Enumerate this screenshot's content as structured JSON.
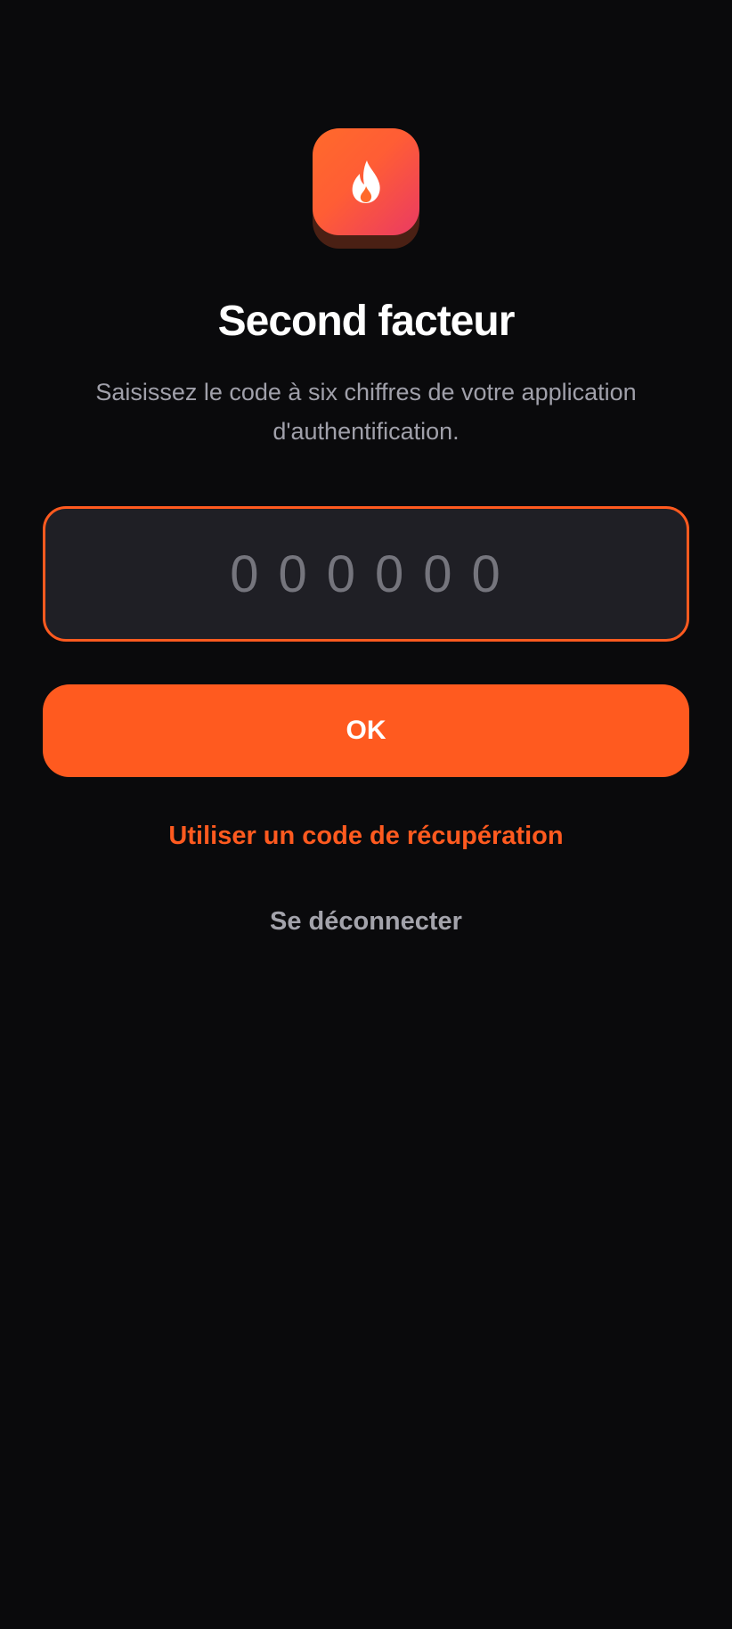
{
  "logo": {
    "icon": "flame-icon",
    "gradient_start": "#ff6a2b",
    "gradient_end": "#ea3a63"
  },
  "title": "Second facteur",
  "subtitle": "Saisissez le code à six chiffres de votre application d'authentification.",
  "code_input": {
    "value": "",
    "placeholder": "000000"
  },
  "ok_button": {
    "label": "OK"
  },
  "recovery_link": {
    "label": "Utiliser un code de récupération"
  },
  "logout_link": {
    "label": "Se déconnecter"
  },
  "colors": {
    "accent": "#ff5a1f",
    "background": "#0a0a0c",
    "input_background": "#1f1f25",
    "muted_text": "#a0a0aa"
  }
}
